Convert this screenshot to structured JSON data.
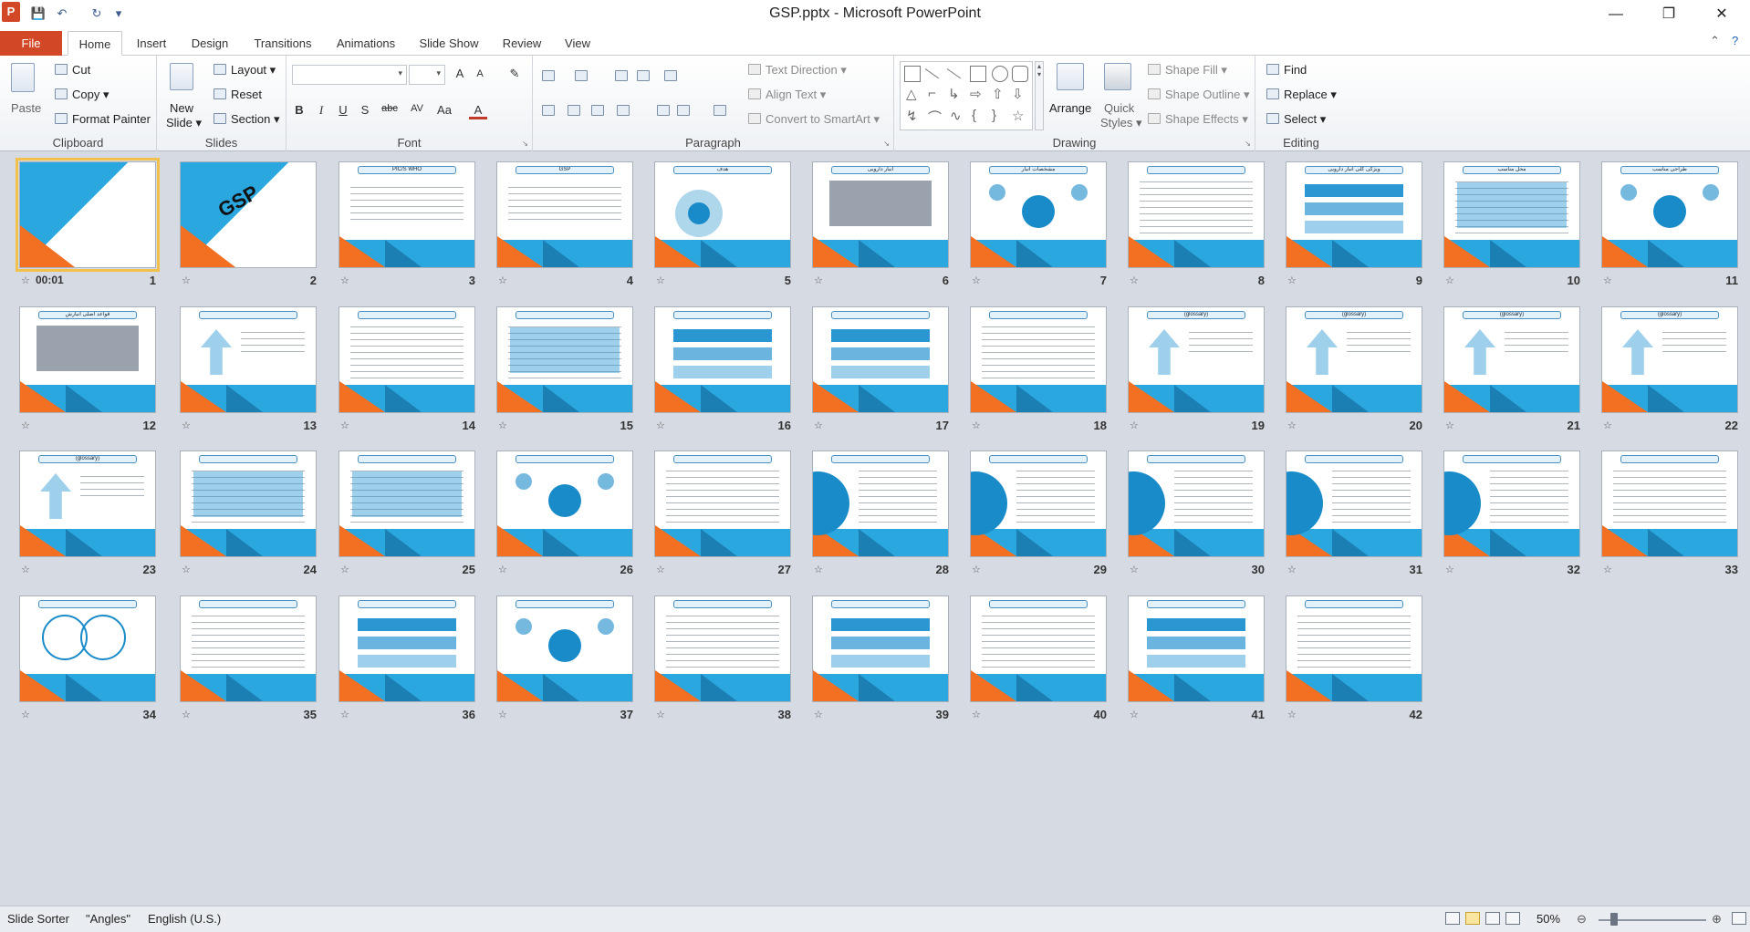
{
  "window": {
    "title": "GSP.pptx - Microsoft PowerPoint",
    "logo_letter": "P",
    "controls": {
      "minimize": "—",
      "maximize": "❐",
      "close": "✕"
    },
    "qat": {
      "save": "💾",
      "undo": "↶",
      "redo": "↻",
      "customize": "▾"
    }
  },
  "tabs": {
    "file": "File",
    "items": [
      "Home",
      "Insert",
      "Design",
      "Transitions",
      "Animations",
      "Slide Show",
      "Review",
      "View"
    ],
    "active": "Home"
  },
  "ribbon": {
    "clipboard": {
      "label": "Clipboard",
      "paste": "Paste",
      "cut": "Cut",
      "copy": "Copy",
      "format_painter": "Format Painter"
    },
    "slides": {
      "label": "Slides",
      "new_slide": "New",
      "new_slide2": "Slide",
      "layout": "Layout",
      "reset": "Reset",
      "section": "Section"
    },
    "font": {
      "label": "Font",
      "bold": "B",
      "italic": "I",
      "underline": "U",
      "shadow": "S",
      "strike": "abc",
      "spacing": "AV",
      "case": "Aa",
      "color": "A",
      "grow": "A",
      "shrink": "A",
      "clear": "✎"
    },
    "paragraph": {
      "label": "Paragraph",
      "text_direction": "Text Direction",
      "align_text": "Align Text",
      "convert_smartart": "Convert to SmartArt"
    },
    "drawing": {
      "label": "Drawing",
      "arrange": "Arrange",
      "quick_styles": "Quick",
      "quick_styles2": "Styles",
      "shape_fill": "Shape Fill",
      "shape_outline": "Shape Outline",
      "shape_effects": "Shape Effects"
    },
    "editing": {
      "label": "Editing",
      "find": "Find",
      "replace": "Replace",
      "select": "Select"
    }
  },
  "slides": [
    {
      "n": "1",
      "title": "",
      "kind": "cover",
      "time": "00:01"
    },
    {
      "n": "2",
      "title": "GSP",
      "kind": "cover2"
    },
    {
      "n": "3",
      "title": "PIC/S  WHO",
      "kind": "logos"
    },
    {
      "n": "4",
      "title": "GSP",
      "kind": "flow"
    },
    {
      "n": "5",
      "title": "هدف",
      "kind": "target"
    },
    {
      "n": "6",
      "title": "انبار دارویی",
      "kind": "img"
    },
    {
      "n": "7",
      "title": "مشخصات انبار",
      "kind": "circles"
    },
    {
      "n": "8",
      "title": "",
      "kind": "text"
    },
    {
      "n": "9",
      "title": "ویژگی کلی انبار دارویی",
      "kind": "blocks"
    },
    {
      "n": "10",
      "title": "محل مناسب",
      "kind": "table"
    },
    {
      "n": "11",
      "title": "طراحی مناسب",
      "kind": "cycle"
    },
    {
      "n": "12",
      "title": "قواعد اصلی انبارش",
      "kind": "photos"
    },
    {
      "n": "13",
      "title": "",
      "kind": "funnel"
    },
    {
      "n": "14",
      "title": "",
      "kind": "text"
    },
    {
      "n": "15",
      "title": "",
      "kind": "table"
    },
    {
      "n": "16",
      "title": "",
      "kind": "blocks"
    },
    {
      "n": "17",
      "title": "",
      "kind": "blocks"
    },
    {
      "n": "18",
      "title": "",
      "kind": "text"
    },
    {
      "n": "19",
      "title": "(glossary)",
      "kind": "arrow"
    },
    {
      "n": "20",
      "title": "(glossary)",
      "kind": "arrow"
    },
    {
      "n": "21",
      "title": "(glossary)",
      "kind": "arrow"
    },
    {
      "n": "22",
      "title": "(glossary)",
      "kind": "arrow"
    },
    {
      "n": "23",
      "title": "(glossary)",
      "kind": "arrow"
    },
    {
      "n": "24",
      "title": "",
      "kind": "table"
    },
    {
      "n": "25",
      "title": "",
      "kind": "table"
    },
    {
      "n": "26",
      "title": "",
      "kind": "hub"
    },
    {
      "n": "27",
      "title": "",
      "kind": "text"
    },
    {
      "n": "28",
      "title": "",
      "kind": "half"
    },
    {
      "n": "29",
      "title": "",
      "kind": "half"
    },
    {
      "n": "30",
      "title": "",
      "kind": "half"
    },
    {
      "n": "31",
      "title": "",
      "kind": "half"
    },
    {
      "n": "32",
      "title": "",
      "kind": "half"
    },
    {
      "n": "33",
      "title": "",
      "kind": "text"
    },
    {
      "n": "34",
      "title": "",
      "kind": "venn"
    },
    {
      "n": "35",
      "title": "",
      "kind": "text"
    },
    {
      "n": "36",
      "title": "",
      "kind": "blocks"
    },
    {
      "n": "37",
      "title": "",
      "kind": "hub"
    },
    {
      "n": "38",
      "title": "",
      "kind": "text"
    },
    {
      "n": "39",
      "title": "",
      "kind": "blocks"
    },
    {
      "n": "40",
      "title": "",
      "kind": "text"
    },
    {
      "n": "41",
      "title": "",
      "kind": "steps"
    },
    {
      "n": "42",
      "title": "",
      "kind": "text"
    }
  ],
  "status": {
    "view": "Slide Sorter",
    "theme": "\"Angles\"",
    "language": "English (U.S.)",
    "zoom": "50%",
    "zoom_fraction": 0.5
  },
  "colors": {
    "accent": "#d24726",
    "slide_blue": "#2aa7de",
    "slide_orange": "#f36f21"
  }
}
